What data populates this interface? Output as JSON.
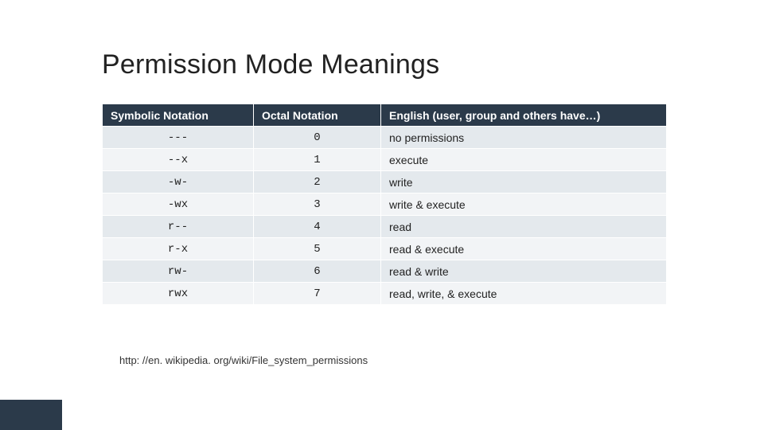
{
  "title": "Permission Mode Meanings",
  "headers": {
    "symbolic": "Symbolic Notation",
    "octal": "Octal Notation",
    "english": "English (user, group and others have…)"
  },
  "rows": [
    {
      "symbolic": "---",
      "octal": "0",
      "english": "no permissions"
    },
    {
      "symbolic": "--x",
      "octal": "1",
      "english": "execute"
    },
    {
      "symbolic": "-w-",
      "octal": "2",
      "english": "write"
    },
    {
      "symbolic": "-wx",
      "octal": "3",
      "english": "write & execute"
    },
    {
      "symbolic": "r--",
      "octal": "4",
      "english": "read"
    },
    {
      "symbolic": "r-x",
      "octal": "5",
      "english": "read & execute"
    },
    {
      "symbolic": "rw-",
      "octal": "6",
      "english": "read & write"
    },
    {
      "symbolic": "rwx",
      "octal": "7",
      "english": "read, write, & execute"
    }
  ],
  "footnote": "http: //en. wikipedia. org/wiki/File_system_permissions",
  "chart_data": {
    "type": "table",
    "title": "Permission Mode Meanings",
    "columns": [
      "Symbolic Notation",
      "Octal Notation",
      "English (user, group and others have…)"
    ],
    "rows": [
      [
        "---",
        "0",
        "no permissions"
      ],
      [
        "--x",
        "1",
        "execute"
      ],
      [
        "-w-",
        "2",
        "write"
      ],
      [
        "-wx",
        "3",
        "write & execute"
      ],
      [
        "r--",
        "4",
        "read"
      ],
      [
        "r-x",
        "5",
        "read & execute"
      ],
      [
        "rw-",
        "6",
        "read & write"
      ],
      [
        "rwx",
        "7",
        "read, write, & execute"
      ]
    ]
  }
}
